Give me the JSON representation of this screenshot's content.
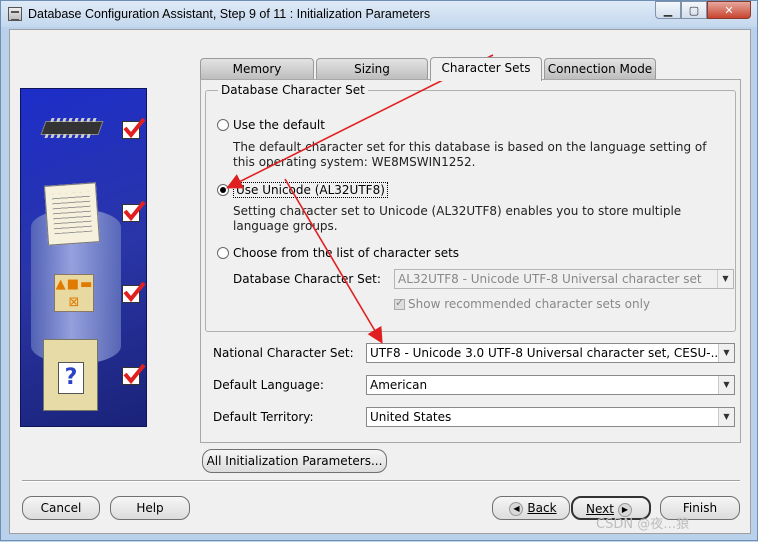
{
  "window": {
    "title": "Database Configuration Assistant, Step 9 of 11 : Initialization Parameters"
  },
  "tabs": [
    {
      "label": "Memory",
      "active": false
    },
    {
      "label": "Sizing",
      "active": false
    },
    {
      "label": "Character Sets",
      "active": true
    },
    {
      "label": "Connection Mode",
      "active": false
    }
  ],
  "db_charset_group": {
    "legend": "Database Character Set",
    "option_default": {
      "label": "Use the default",
      "selected": false,
      "description": "The default character set for this database is based on the language setting of this operating system: WE8MSWIN1252."
    },
    "option_unicode": {
      "label": "Use Unicode (AL32UTF8)",
      "selected": true,
      "description": "Setting character set to Unicode (AL32UTF8) enables you to store multiple language groups."
    },
    "option_choose": {
      "label": "Choose from the list of character sets",
      "selected": false
    },
    "charset_label": "Database Character Set:",
    "charset_value": "AL32UTF8 - Unicode UTF-8 Universal character set",
    "show_recommended_label": "Show recommended character sets only",
    "show_recommended_checked": true
  },
  "fields": {
    "national_label": "National Character Set:",
    "national_value": "UTF8 - Unicode 3.0 UTF-8 Universal character set, CESU-...",
    "language_label": "Default Language:",
    "language_value": "American",
    "territory_label": "Default Territory:",
    "territory_value": "United States"
  },
  "buttons": {
    "all_params": "All Initialization Parameters...",
    "cancel": "Cancel",
    "help": "Help",
    "back": "Back",
    "next": "Next",
    "finish": "Finish"
  },
  "watermark": "CSDN @夜…狼",
  "colors": {
    "annotation_arrow": "#e02020",
    "side_panel": "#1d2ec9"
  }
}
